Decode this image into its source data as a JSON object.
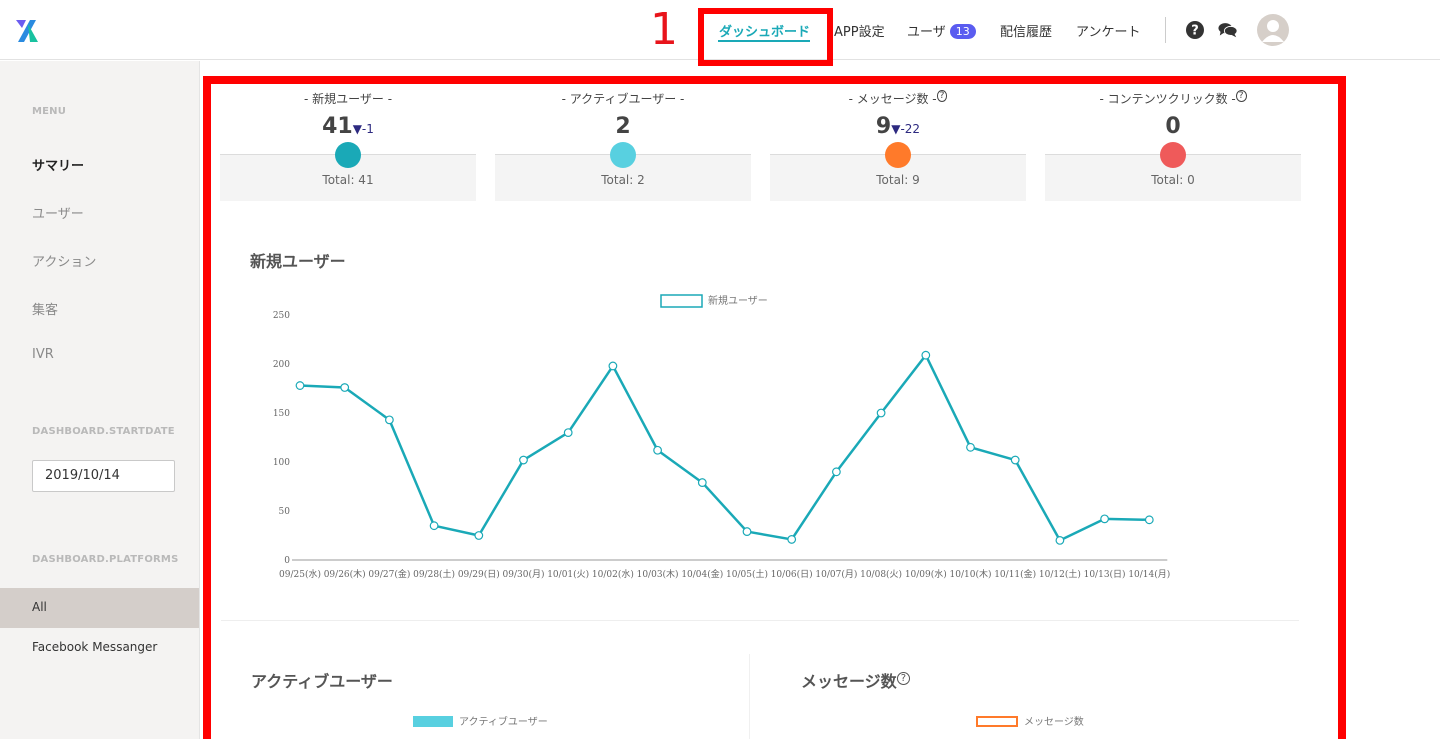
{
  "annotation_number": "1",
  "header": {
    "nav": [
      {
        "label": "ダッシュボード",
        "active": true
      },
      {
        "label": "APP設定"
      },
      {
        "label": "ユーザ",
        "badge": "13"
      },
      {
        "label": "配信履歴"
      },
      {
        "label": "アンケート"
      }
    ],
    "icons": [
      "question-circle-icon",
      "chat-bubbles-icon",
      "user-avatar-icon"
    ],
    "accent_color": "#1aa9b7"
  },
  "sidebar": {
    "menu_heading": "MENU",
    "items": [
      {
        "label": "サマリー",
        "active": true
      },
      {
        "label": "ユーザー"
      },
      {
        "label": "アクション"
      },
      {
        "label": "集客"
      },
      {
        "label": "IVR"
      }
    ],
    "startdate_heading": "DASHBOARD.STARTDATE",
    "startdate_value": "2019/10/14",
    "platforms_heading": "DASHBOARD.PLATFORMS",
    "platforms": [
      {
        "label": "All",
        "selected": true
      },
      {
        "label": "Facebook Messanger"
      }
    ]
  },
  "stats": [
    {
      "title": "- 新規ユーザー -",
      "help": false,
      "value": "41",
      "delta": "▼-1",
      "total": "Total: 41",
      "color": "#1aa9b7"
    },
    {
      "title": "- アクティブユーザー -",
      "help": false,
      "value": "2",
      "delta": "",
      "total": "Total: 2",
      "color": "#58d0e0"
    },
    {
      "title": "- メッセージ数 -",
      "help": true,
      "value": "9",
      "delta": "▼-22",
      "total": "Total: 9",
      "color": "#ff7a2a"
    },
    {
      "title": "- コンテンツクリック数 -",
      "help": true,
      "value": "0",
      "delta": "",
      "total": "Total: 0",
      "color": "#ef5a5a"
    }
  ],
  "help_glyph": "?",
  "sections": {
    "new_users_title": "新規ユーザー",
    "active_users_title": "アクティブユーザー",
    "messages_title": "メッセージ数",
    "active_users_legend": "アクティブユーザー",
    "messages_legend": "メッセージ数"
  },
  "chart_data": {
    "type": "line",
    "title": "新規ユーザー",
    "categories": [
      "09/25(水)",
      "09/26(木)",
      "09/27(金)",
      "09/28(土)",
      "09/29(日)",
      "09/30(月)",
      "10/01(火)",
      "10/02(水)",
      "10/03(木)",
      "10/04(金)",
      "10/05(土)",
      "10/06(日)",
      "10/07(月)",
      "10/08(火)",
      "10/09(水)",
      "10/10(木)",
      "10/11(金)",
      "10/12(土)",
      "10/13(日)",
      "10/14(月)"
    ],
    "series": [
      {
        "name": "新規ユーザー",
        "color": "#1aa9b7",
        "values": [
          178,
          176,
          143,
          35,
          25,
          102,
          130,
          198,
          112,
          79,
          29,
          21,
          90,
          150,
          209,
          115,
          102,
          20,
          42,
          41
        ]
      }
    ],
    "yticks": [
      0,
      50,
      100,
      150,
      200,
      250
    ],
    "ylim": [
      0,
      250
    ],
    "legend_position": "top-center",
    "grid": false
  }
}
